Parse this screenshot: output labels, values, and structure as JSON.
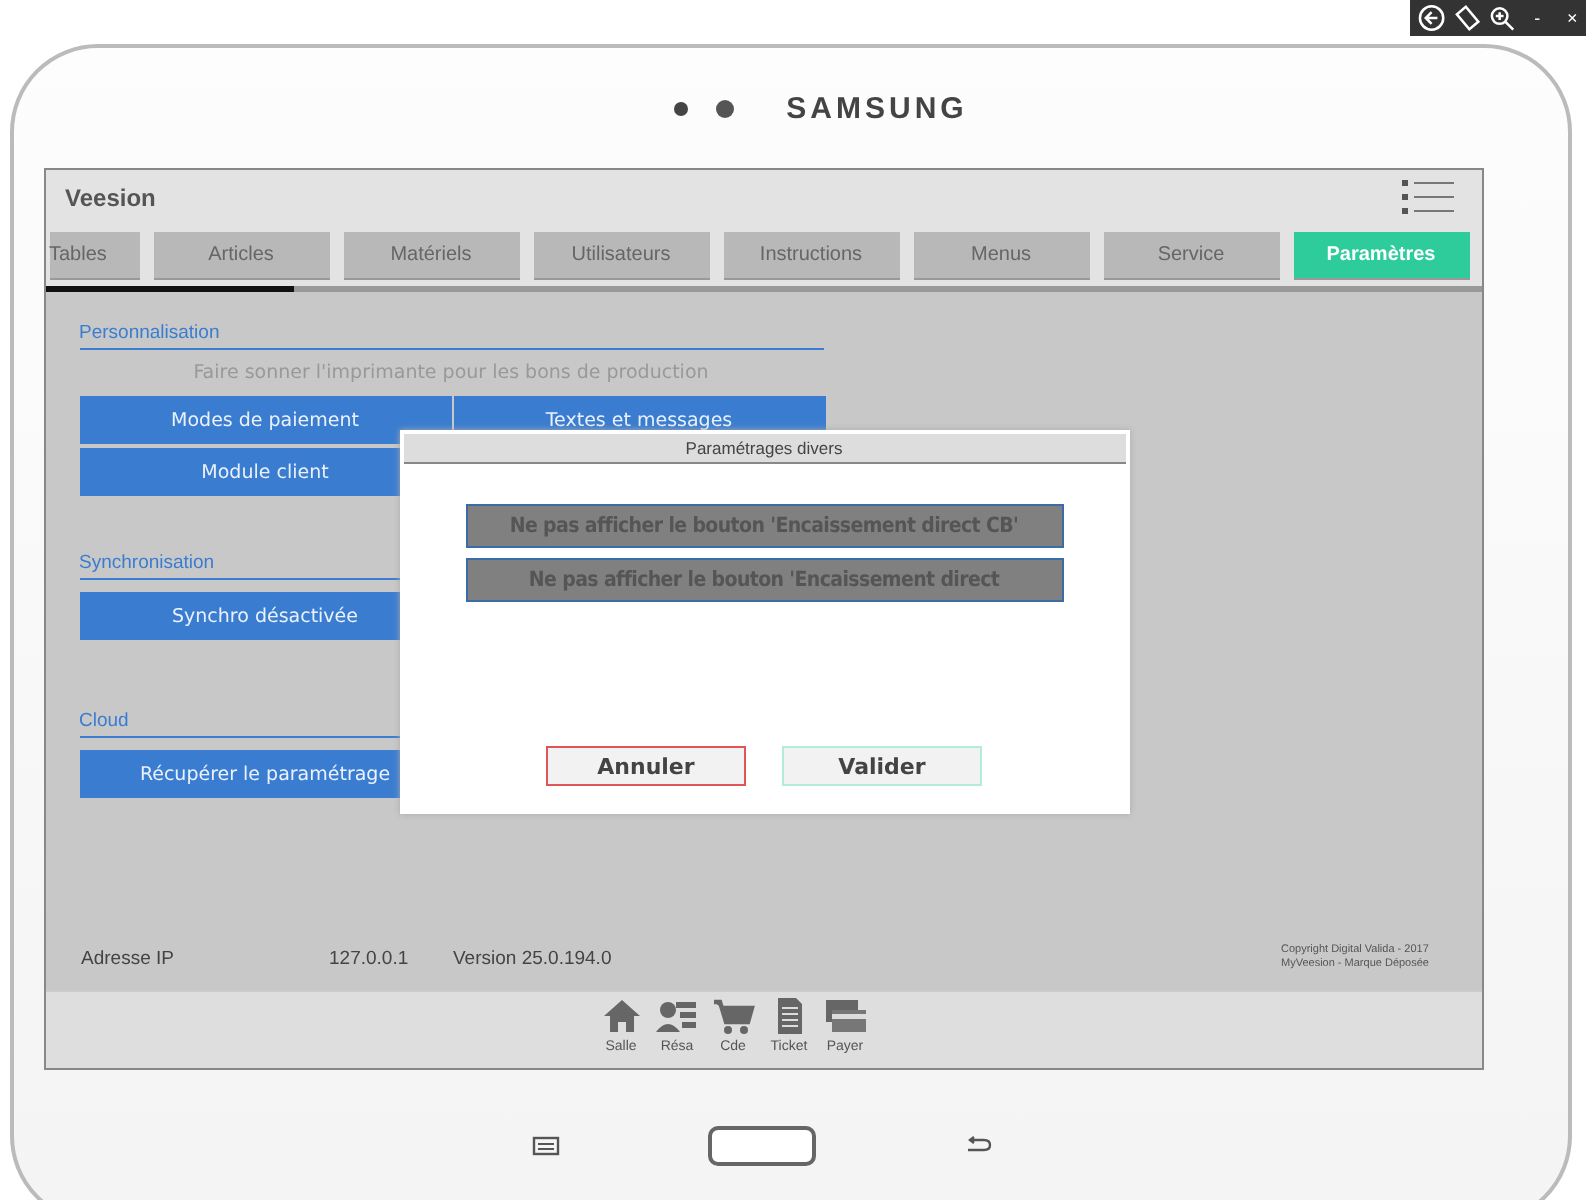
{
  "emulator_toolbar": {
    "minimize": "-",
    "close": "×"
  },
  "device": {
    "brand": "SAMSUNG"
  },
  "app": {
    "title": "Veesion"
  },
  "tabs": [
    {
      "label": "Tables",
      "selected": false
    },
    {
      "label": "Articles",
      "selected": false
    },
    {
      "label": "Matériels",
      "selected": false
    },
    {
      "label": "Utilisateurs",
      "selected": false
    },
    {
      "label": "Instructions",
      "selected": false
    },
    {
      "label": "Menus",
      "selected": false
    },
    {
      "label": "Service",
      "selected": false
    },
    {
      "label": "Paramètres",
      "selected": true
    }
  ],
  "sections": [
    {
      "title": "Personnalisation",
      "hint": "Faire sonner l'imprimante pour les bons de production",
      "buttons": [
        "Modes de paiement",
        "Textes et messages",
        "Module client"
      ]
    },
    {
      "title": "Synchronisation",
      "buttons": [
        "Synchro désactivée"
      ]
    },
    {
      "title": "Cloud",
      "buttons": [
        "Récupérer le paramétrage"
      ]
    }
  ],
  "footer": {
    "ip_label": "Adresse IP",
    "ip": "127.0.0.1",
    "version": "Version 25.0.194.0",
    "copyright": [
      "Copyright Digital Valida - 2017",
      "MyVeesion - Marque Déposée"
    ]
  },
  "nav": [
    {
      "label": "Salle"
    },
    {
      "label": "Résa"
    },
    {
      "label": "Cde"
    },
    {
      "label": "Ticket"
    },
    {
      "label": "Payer"
    }
  ],
  "dialog": {
    "title": "Paramétrages divers",
    "options": [
      "Ne pas afficher le bouton 'Encaissement direct CB'",
      "Ne pas afficher le bouton 'Encaissement direct"
    ],
    "buttons": [
      {
        "label": "Annuler",
        "kind": "cancel"
      },
      {
        "label": "Valider",
        "kind": "confirm"
      }
    ]
  }
}
